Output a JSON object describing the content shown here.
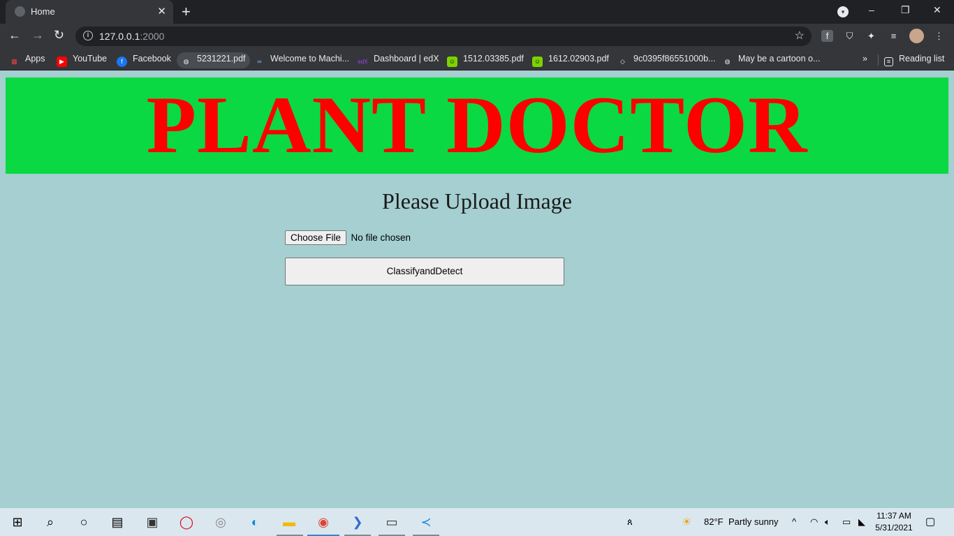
{
  "browser": {
    "tab_title": "Home",
    "tab_close": "✕",
    "new_tab": "+",
    "url_host": "127.0.0.1",
    "url_port": ":2000",
    "window_controls": [
      "–",
      "❐",
      "✕"
    ]
  },
  "bookmarks": [
    {
      "label": "Apps",
      "icon": "apps-grid-icon",
      "color": "#e8453c"
    },
    {
      "label": "YouTube",
      "icon": "youtube-icon",
      "color": "#ff0000"
    },
    {
      "label": "Facebook",
      "icon": "facebook-icon",
      "color": "#1877f2"
    },
    {
      "label": "5231221.pdf",
      "icon": "globe-icon",
      "color": "#e8eaed"
    },
    {
      "label": "Welcome to Machi...",
      "icon": "coursera-icon",
      "color": "#8ab4f8"
    },
    {
      "label": "Dashboard | edX",
      "icon": "edx-icon",
      "color": "#a142f4"
    },
    {
      "label": "1512.03385.pdf",
      "icon": "smiley-icon",
      "color": "#7cd300"
    },
    {
      "label": "1612.02903.pdf",
      "icon": "smiley-icon",
      "color": "#7cd300"
    },
    {
      "label": "9c0395f86551000b...",
      "icon": "diamond-icon",
      "color": "#e8eaed"
    },
    {
      "label": "May be a cartoon o...",
      "icon": "globe-icon",
      "color": "#e8eaed"
    }
  ],
  "bookmarks_overflow": "»",
  "reading_list": "Reading list",
  "page": {
    "banner_title": "PLANT DOCTOR",
    "upload_heading": "Please Upload Image",
    "choose_file_label": "Choose File",
    "no_file_text": "No file chosen",
    "submit_label": "ClassifyandDetect",
    "colors": {
      "banner_bg": "#0ad944",
      "banner_text": "#ff0000",
      "page_bg": "#a5cfd0"
    }
  },
  "taskbar": {
    "weather_temp": "82°F",
    "weather_text": "Partly sunny",
    "time": "11:37 AM",
    "date": "5/31/2021"
  }
}
